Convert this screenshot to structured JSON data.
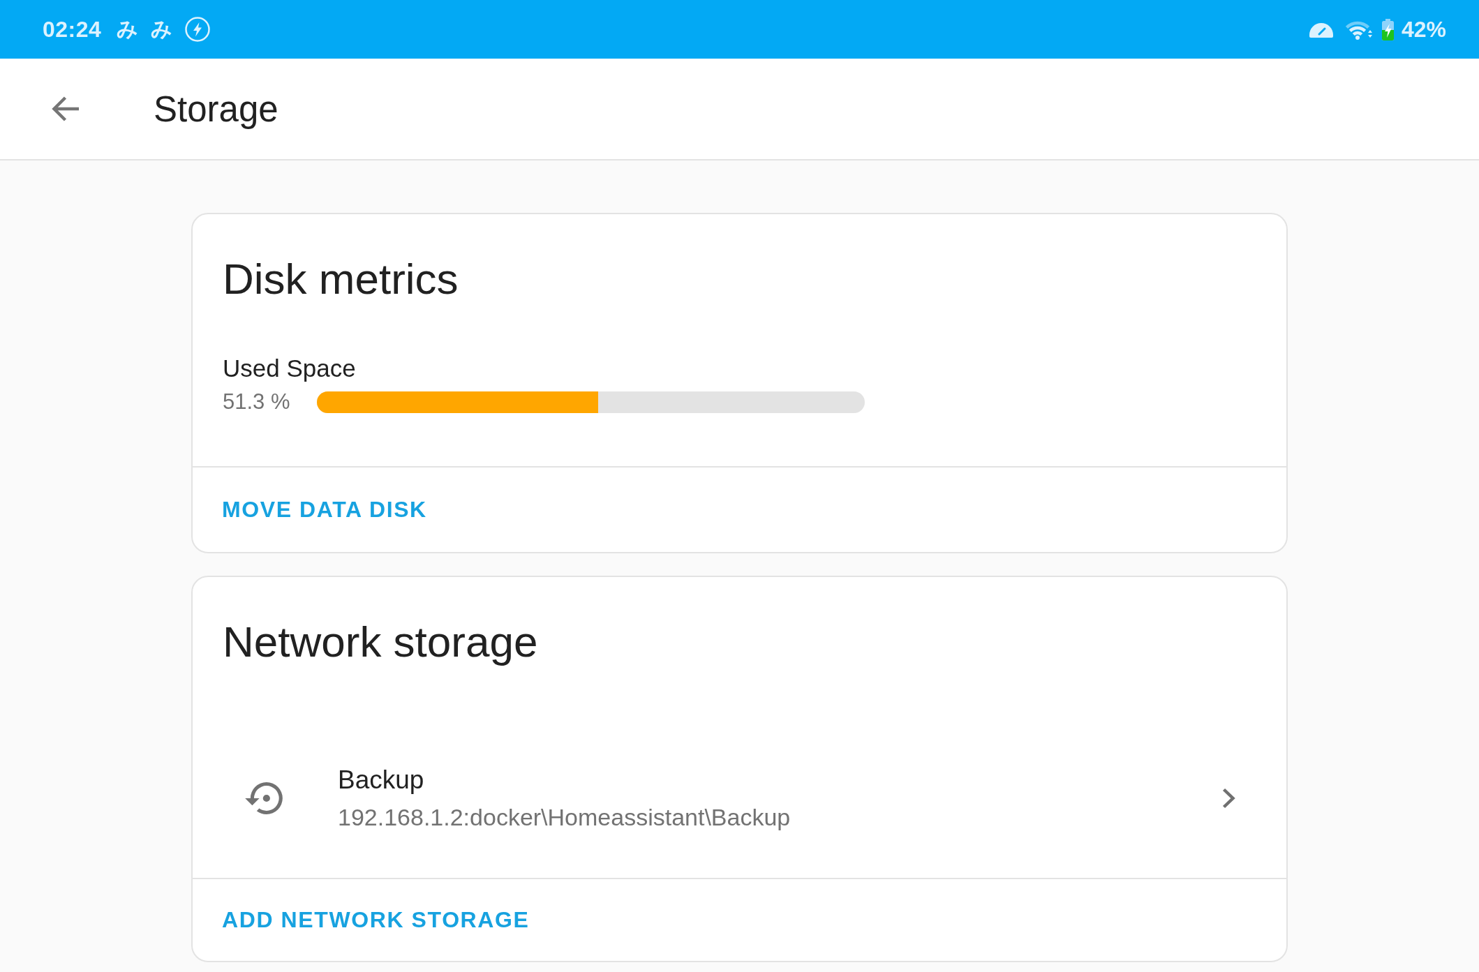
{
  "status_bar": {
    "time": "02:24",
    "notifications": [
      "み",
      "み"
    ],
    "battery": "42%"
  },
  "app_bar": {
    "title": "Storage"
  },
  "disk_metrics": {
    "title": "Disk metrics",
    "metric": {
      "label": "Used Space",
      "reading": "51.3 %",
      "level": 0.513
    },
    "action": "MOVE DATA DISK"
  },
  "network_storage": {
    "title": "Network storage",
    "mounts": [
      {
        "name": "Backup",
        "path": "192.168.1.2:docker\\Homeassistant\\Backup"
      }
    ],
    "action": "ADD NETWORK STORAGE"
  }
}
